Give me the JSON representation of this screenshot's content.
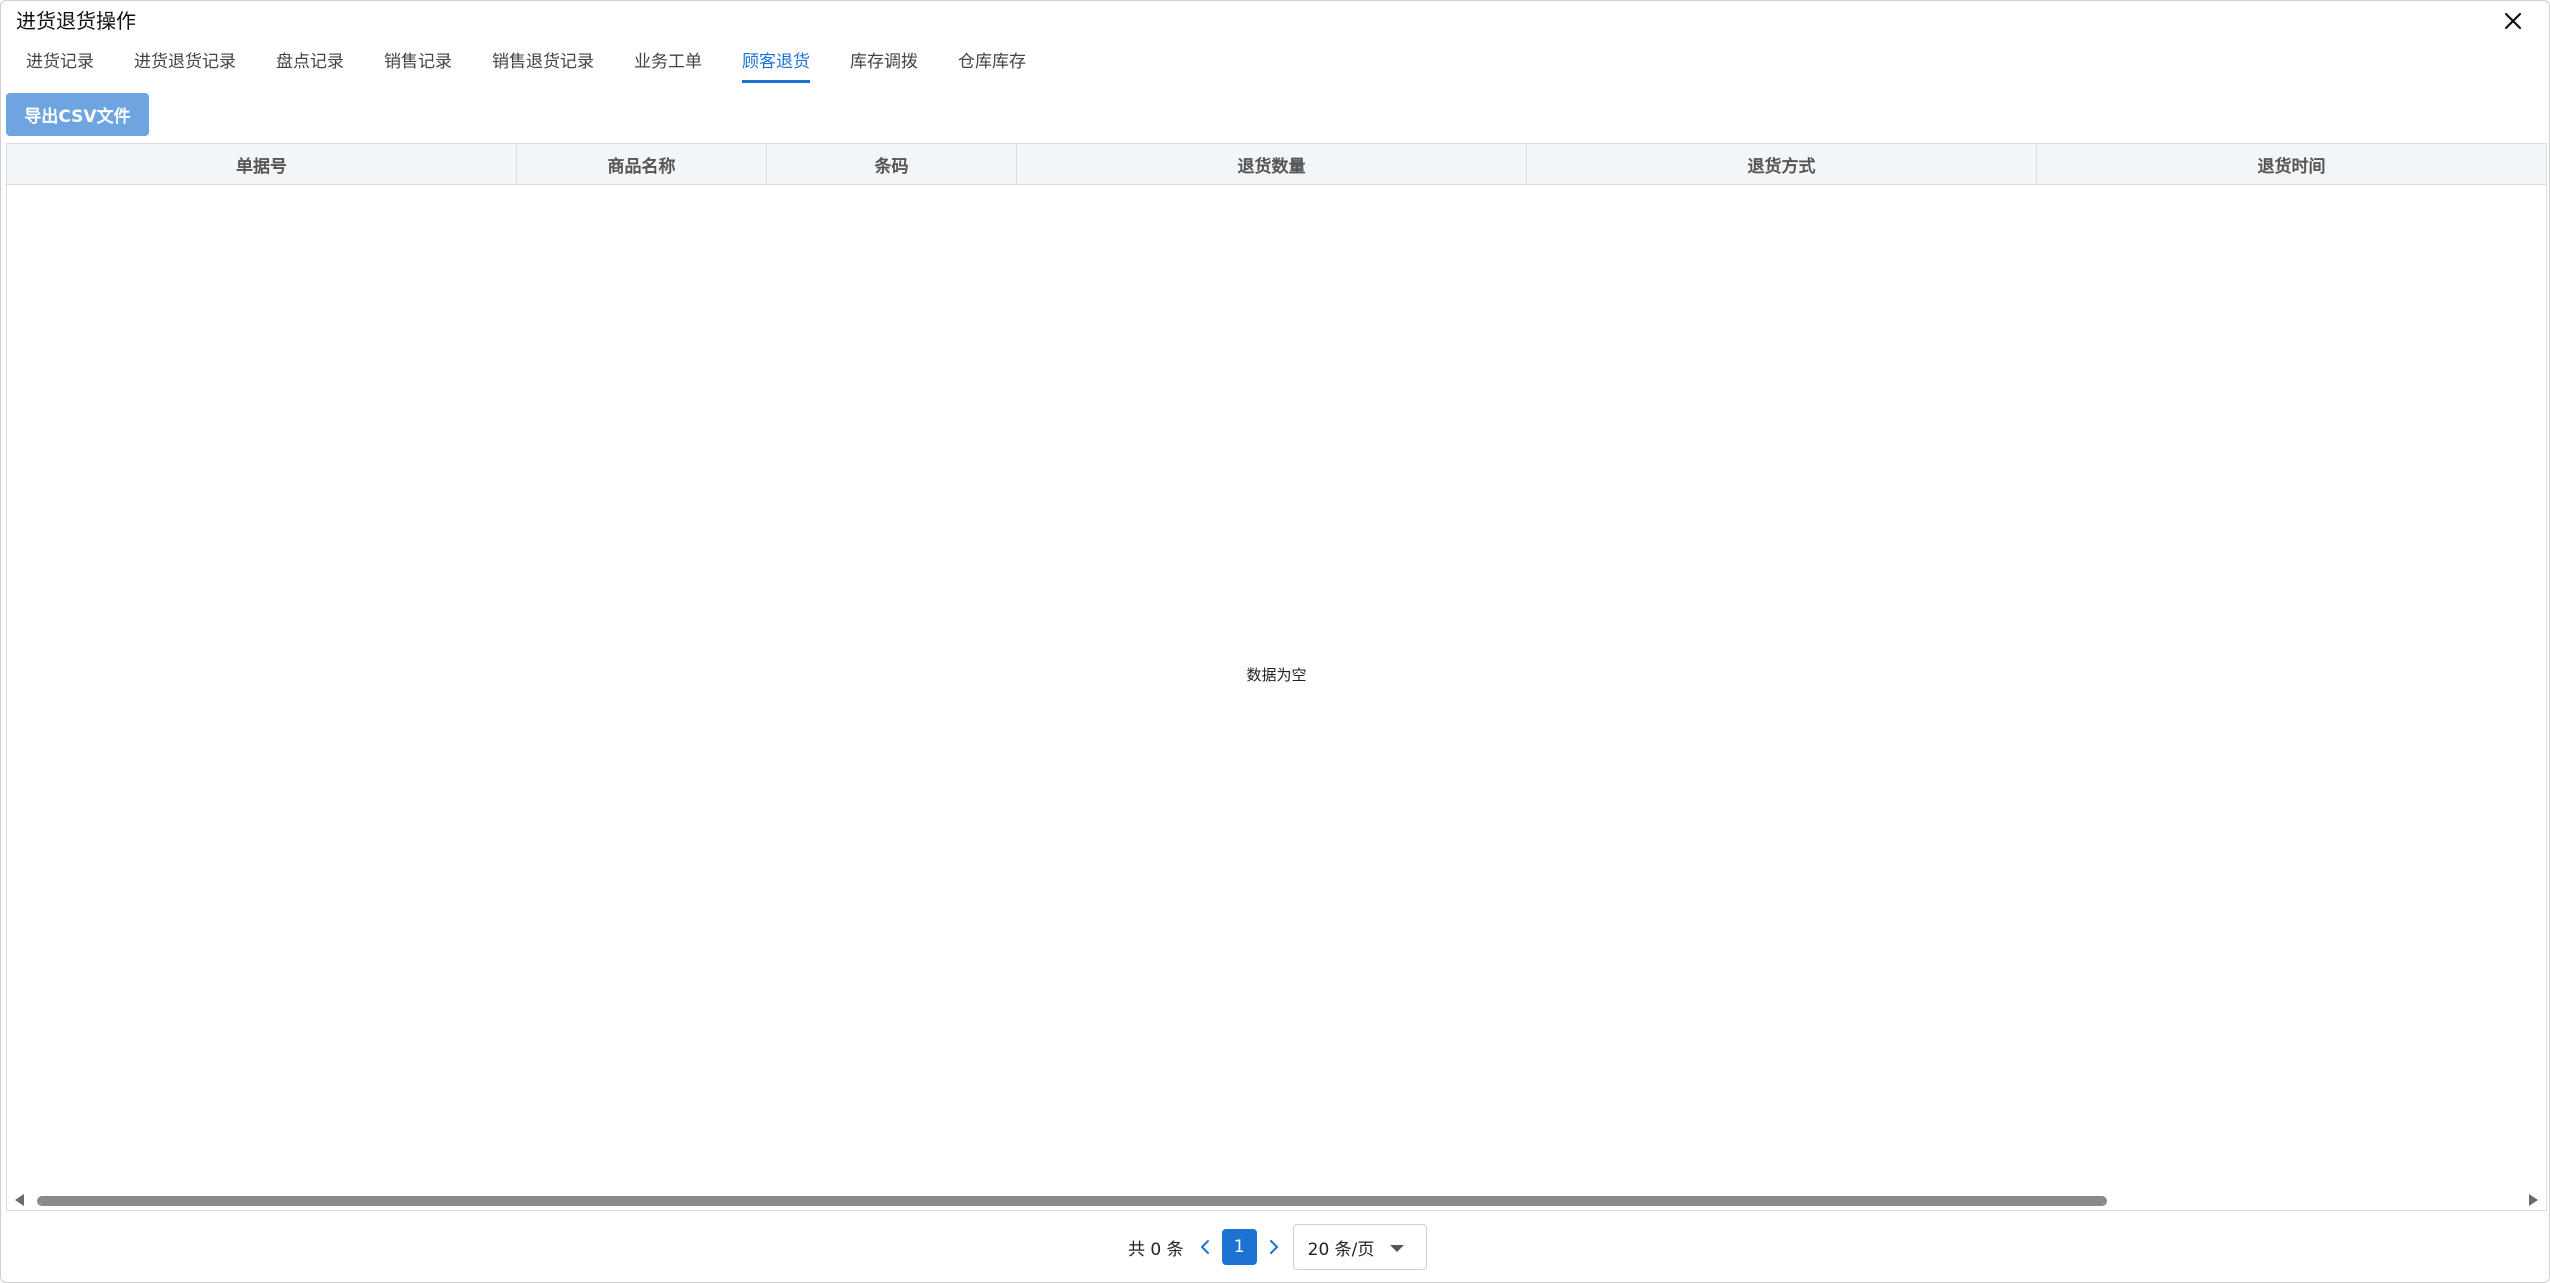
{
  "window": {
    "title": "进货退货操作"
  },
  "tabs": [
    {
      "label": "进货记录"
    },
    {
      "label": "进货退货记录"
    },
    {
      "label": "盘点记录"
    },
    {
      "label": "销售记录"
    },
    {
      "label": "销售退货记录"
    },
    {
      "label": "业务工单"
    },
    {
      "label": "顾客退货",
      "active": true
    },
    {
      "label": "库存调拨"
    },
    {
      "label": "仓库库存"
    }
  ],
  "toolbar": {
    "export_label": "导出CSV文件"
  },
  "table": {
    "columns": [
      {
        "label": "单据号"
      },
      {
        "label": "商品名称"
      },
      {
        "label": "条码"
      },
      {
        "label": "退货数量"
      },
      {
        "label": "退货方式"
      },
      {
        "label": "退货时间"
      }
    ],
    "empty_text": "数据为空"
  },
  "pagination": {
    "total_text": "共 0 条",
    "current_page": "1",
    "page_size": "20 条/页"
  },
  "colors": {
    "accent": "#1c73d2",
    "export_button": "#6ea4e0",
    "header_bg": "#f3f6f8"
  }
}
